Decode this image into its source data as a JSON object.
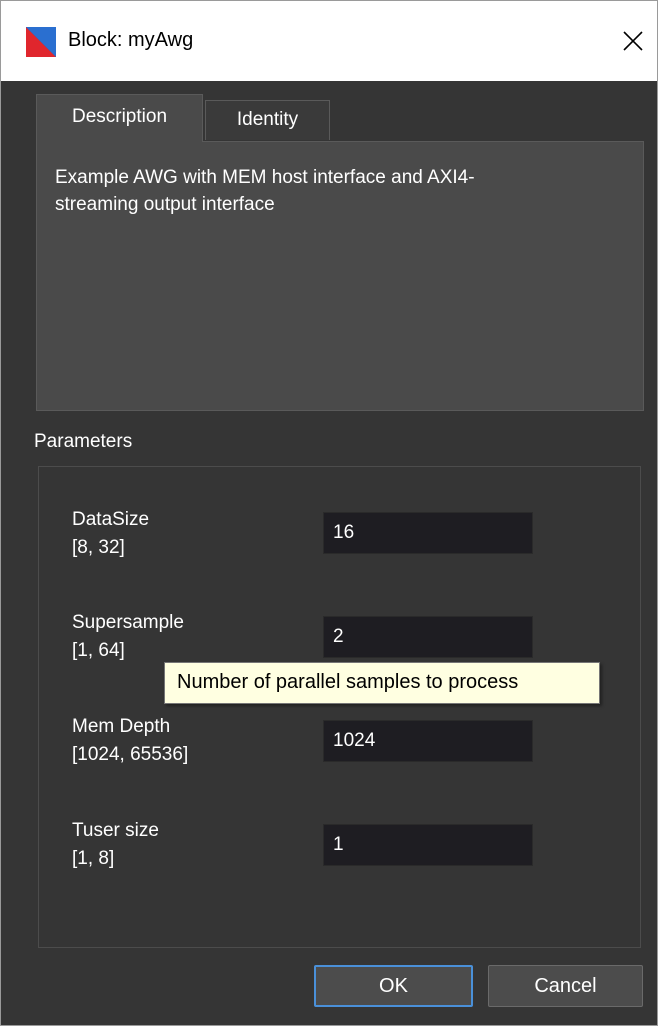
{
  "window": {
    "title": "Block: myAwg",
    "icon": "app-logo-icon",
    "accent": "#4a90d9"
  },
  "tabs": [
    {
      "label": "Description",
      "selected": true
    },
    {
      "label": "Identity",
      "selected": false
    }
  ],
  "description": {
    "line1": "Example AWG with MEM host interface and AXI4-",
    "line2": "streaming output interface"
  },
  "parameters": {
    "label": "Parameters",
    "items": [
      {
        "name": "DataSize",
        "range": "[8, 32]",
        "value": "16"
      },
      {
        "name": "Supersample",
        "range": "[1, 64]",
        "value": "2"
      },
      {
        "name": "Mem Depth",
        "range": "[1024, 65536]",
        "value": "1024"
      },
      {
        "name": "Tuser size",
        "range": "[1, 8]",
        "value": "1"
      }
    ]
  },
  "tooltip": {
    "text": "Number of parallel samples to process"
  },
  "buttons": {
    "ok": "OK",
    "cancel": "Cancel"
  }
}
